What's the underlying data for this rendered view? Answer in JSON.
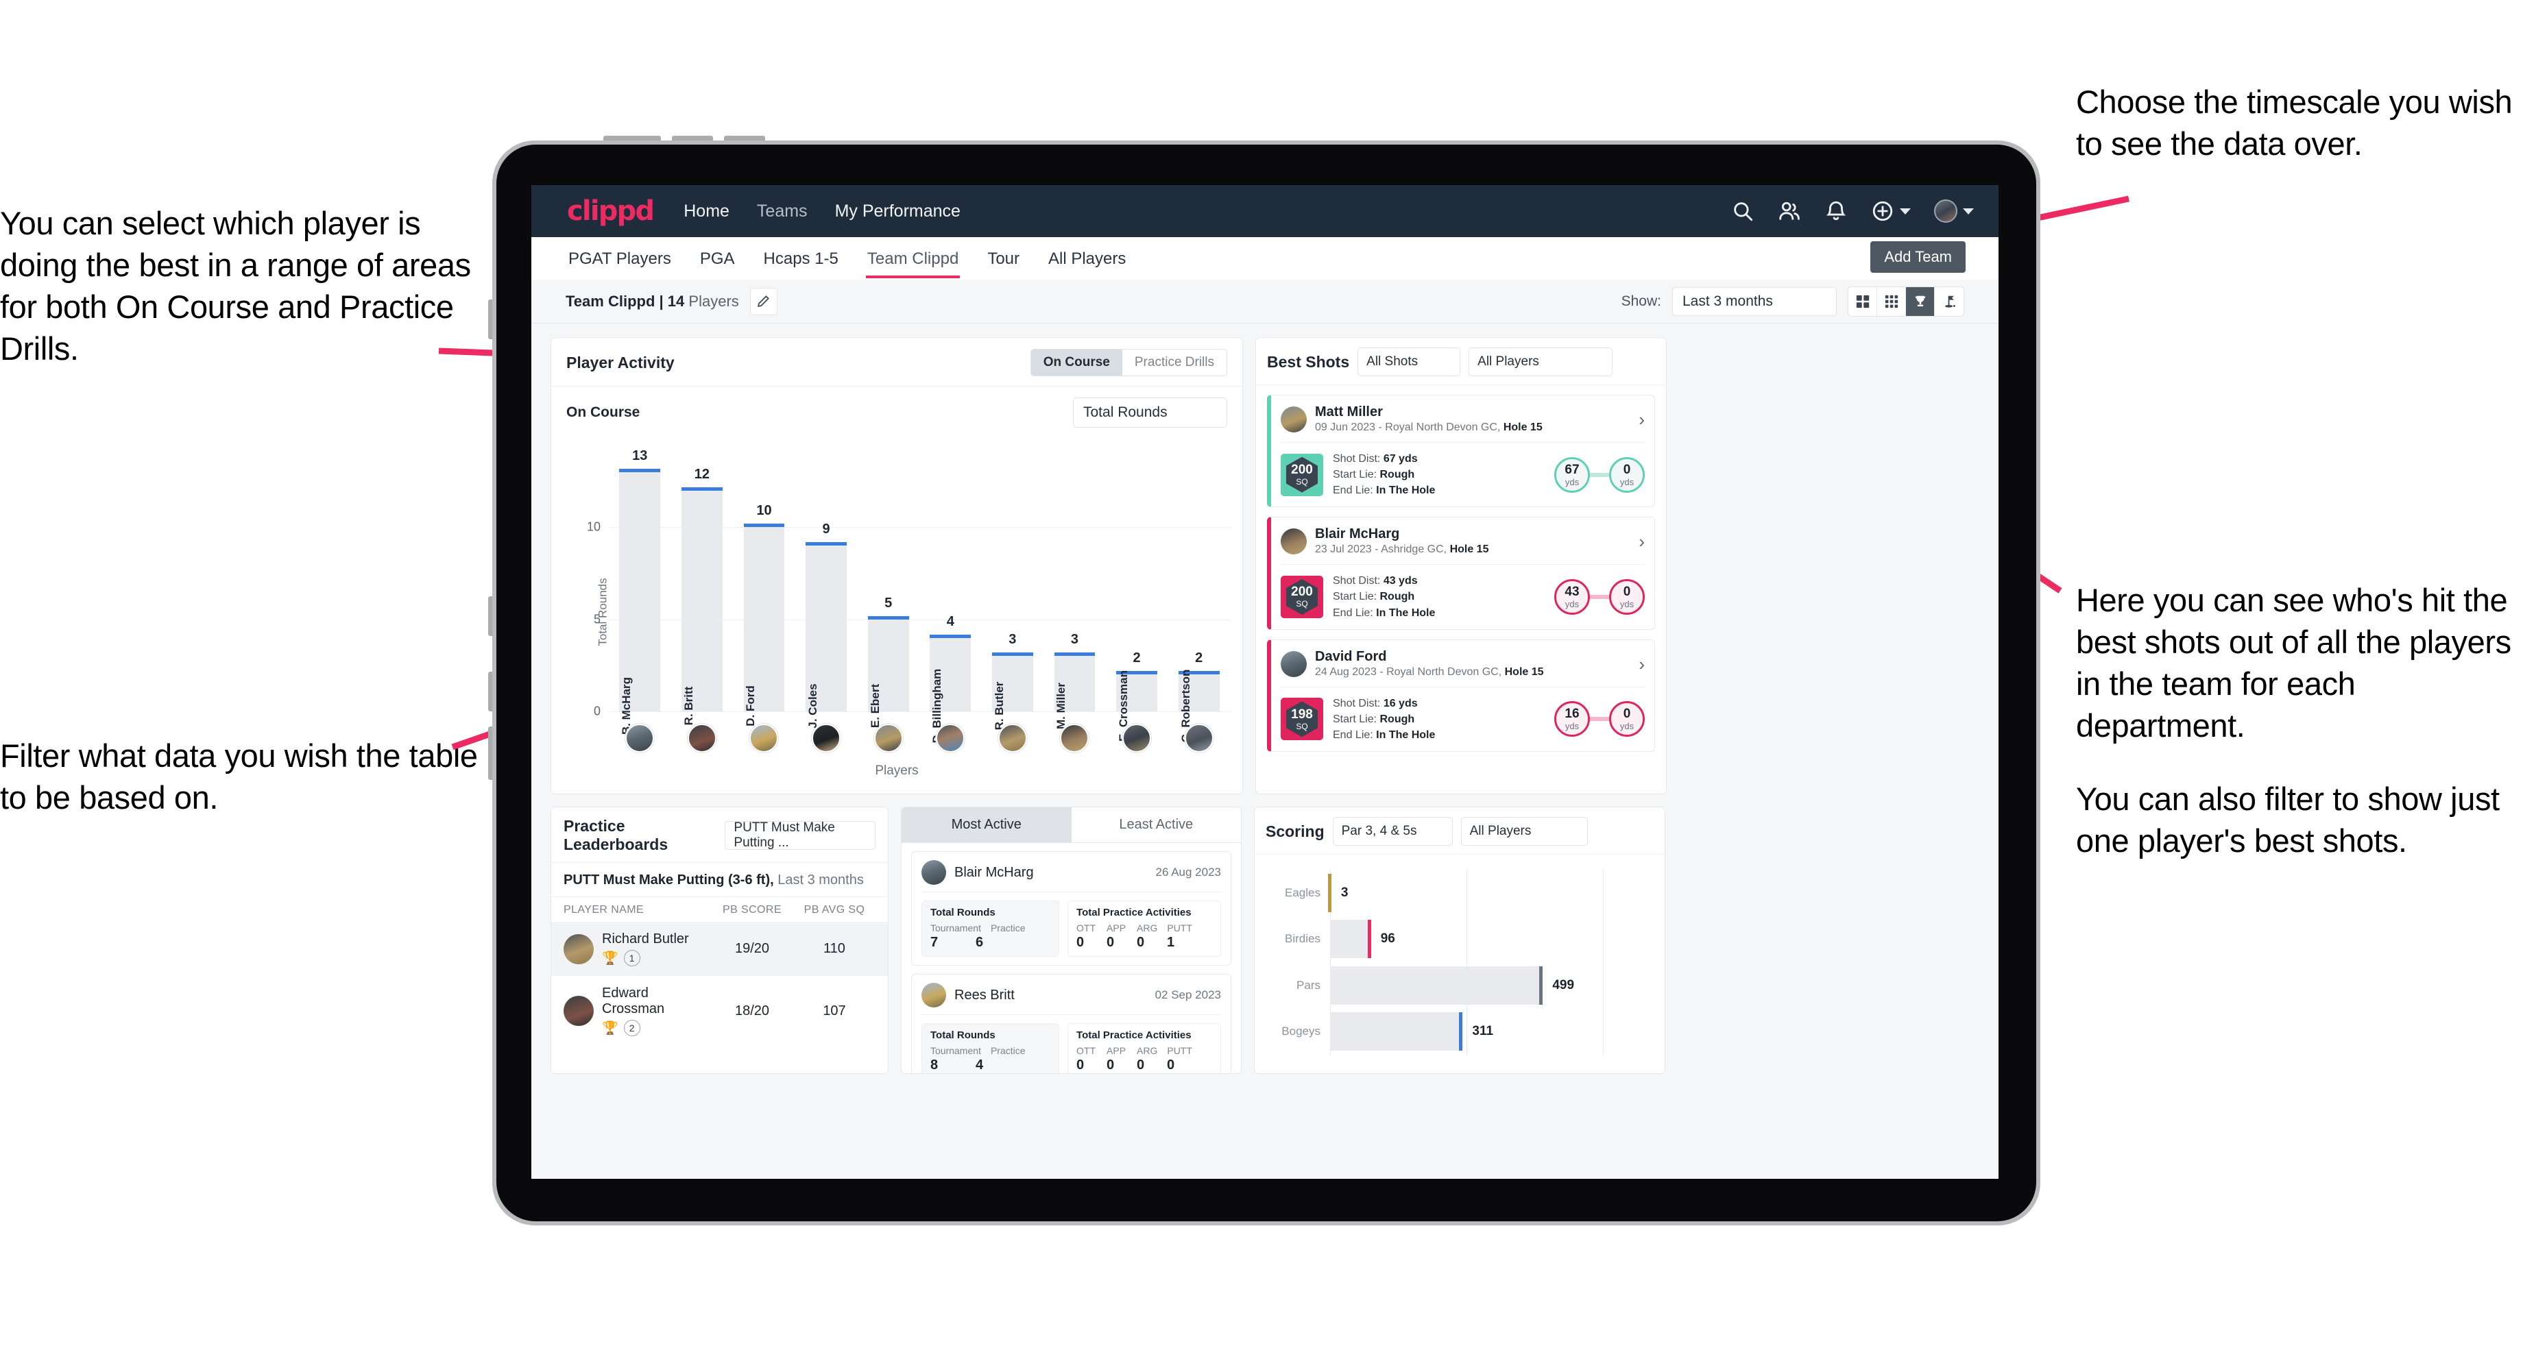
{
  "annotations": {
    "left_top": "You can select which player is doing the best in a range of areas for both On Course and Practice Drills.",
    "left_bottom": "Filter what data you wish the table to be based on.",
    "right_top": "Choose the timescale you wish to see the data over.",
    "right_mid": "Here you can see who's hit the best shots out of all the players in the team for each department.",
    "right_bottom": "You can also filter to show just one player's best shots."
  },
  "navbar": {
    "brand": "clippd",
    "links": [
      {
        "label": "Home"
      },
      {
        "label": "Teams"
      },
      {
        "label": "My Performance"
      }
    ],
    "icons": [
      "search-icon",
      "people-icon",
      "bell-icon",
      "plus-circle-icon",
      "avatar"
    ]
  },
  "subtabs": {
    "items": [
      {
        "label": "PGAT Players",
        "active": false
      },
      {
        "label": "PGA",
        "active": false
      },
      {
        "label": "Hcaps 1-5",
        "active": false
      },
      {
        "label": "Team Clippd",
        "active": true
      },
      {
        "label": "Tour",
        "active": false
      },
      {
        "label": "All Players",
        "active": false
      }
    ],
    "tooltip": "Add Team"
  },
  "toolbar": {
    "team_name": "Team Clippd",
    "team_sep": "|",
    "team_count": "14",
    "team_count_label": "Players",
    "edit_icon": "pencil-icon",
    "show_label": "Show:",
    "timescale_value": "Last 3 months",
    "view_buttons": [
      {
        "icon": "grid-2x2-icon",
        "active": false
      },
      {
        "icon": "grid-3x3-icon",
        "active": false
      },
      {
        "icon": "trophy-icon",
        "active": true
      },
      {
        "icon": "golf-flag-icon",
        "active": false
      }
    ]
  },
  "player_activity": {
    "title": "Player Activity",
    "segments": [
      {
        "label": "On Course",
        "active": true
      },
      {
        "label": "Practice Drills",
        "active": false
      }
    ],
    "sub_label": "On Course",
    "metric_dropdown": "Total Rounds"
  },
  "chart_data": [
    {
      "type": "bar",
      "title": "Player Activity",
      "xlabel": "Players",
      "ylabel": "Total Rounds",
      "ylim": [
        0,
        14
      ],
      "yticks": [
        0,
        5,
        10
      ],
      "grid": true,
      "categories": [
        "B. McHarg",
        "R. Britt",
        "D. Ford",
        "J. Coles",
        "E. Ebert",
        "D. Billingham",
        "R. Butler",
        "M. Miller",
        "E. Crossman",
        "C. Robertson"
      ],
      "values": [
        13,
        12,
        10,
        9,
        5,
        4,
        3,
        3,
        2,
        2
      ]
    },
    {
      "type": "bar",
      "title": "Scoring",
      "orientation": "horizontal",
      "categories": [
        "Eagles",
        "Birdies",
        "Pars",
        "Bogeys"
      ],
      "values": [
        3,
        96,
        499,
        311
      ],
      "xlim": [
        0,
        640
      ],
      "grid": true,
      "colors": [
        "#c0973f",
        "#ec2b62",
        "#6b7481",
        "#3b7ddd"
      ]
    }
  ],
  "best_shots": {
    "title": "Best Shots",
    "shot_filter": "All Shots",
    "player_filter": "All Players",
    "shots": [
      {
        "name": "Matt Miller",
        "meta_date": "09 Jun 2023 - Royal North Devon GC,",
        "meta_hole": "Hole 15",
        "sq_value": "200",
        "sq_unit": "SQ",
        "accent": "teal",
        "shot_dist_label": "Shot Dist:",
        "shot_dist_value": "67 yds",
        "start_lie_label": "Start Lie:",
        "start_lie_value": "Rough",
        "end_lie_label": "End Lie:",
        "end_lie_value": "In The Hole",
        "from_value": "67",
        "from_unit": "yds",
        "to_value": "0",
        "to_unit": "yds"
      },
      {
        "name": "Blair McHarg",
        "meta_date": "23 Jul 2023 - Ashridge GC,",
        "meta_hole": "Hole 15",
        "sq_value": "200",
        "sq_unit": "SQ",
        "accent": "pink",
        "shot_dist_label": "Shot Dist:",
        "shot_dist_value": "43 yds",
        "start_lie_label": "Start Lie:",
        "start_lie_value": "Rough",
        "end_lie_label": "End Lie:",
        "end_lie_value": "In The Hole",
        "from_value": "43",
        "from_unit": "yds",
        "to_value": "0",
        "to_unit": "yds"
      },
      {
        "name": "David Ford",
        "meta_date": "24 Aug 2023 - Royal North Devon GC,",
        "meta_hole": "Hole 15",
        "sq_value": "198",
        "sq_unit": "SQ",
        "accent": "pink",
        "shot_dist_label": "Shot Dist:",
        "shot_dist_value": "16 yds",
        "start_lie_label": "Start Lie:",
        "start_lie_value": "Rough",
        "end_lie_label": "End Lie:",
        "end_lie_value": "In The Hole",
        "from_value": "16",
        "from_unit": "yds",
        "to_value": "0",
        "to_unit": "yds"
      }
    ]
  },
  "practice_leaderboards": {
    "title": "Practice Leaderboards",
    "drill_dropdown": "PUTT Must Make Putting ...",
    "subtitle_bold": "PUTT Must Make Putting (3-6 ft),",
    "subtitle_rest": "Last 3 months",
    "columns": [
      "PLAYER NAME",
      "PB SCORE",
      "PB AVG SQ"
    ],
    "rows": [
      {
        "name": "Richard Butler",
        "rank": "1",
        "trophy": "gold",
        "pb_score": "19/20",
        "pb_avg_sq": "110"
      },
      {
        "name": "Edward Crossman",
        "rank": "2",
        "trophy": "silver",
        "pb_score": "18/20",
        "pb_avg_sq": "107"
      }
    ]
  },
  "activity": {
    "tabs": [
      {
        "label": "Most Active",
        "active": true
      },
      {
        "label": "Least Active",
        "active": false
      }
    ],
    "cards": [
      {
        "name": "Blair McHarg",
        "date": "26 Aug 2023",
        "rounds_title": "Total Rounds",
        "rounds_labels": [
          "Tournament",
          "Practice"
        ],
        "rounds_values": [
          "7",
          "6"
        ],
        "practice_title": "Total Practice Activities",
        "practice_labels": [
          "OTT",
          "APP",
          "ARG",
          "PUTT"
        ],
        "practice_values": [
          "0",
          "0",
          "0",
          "1"
        ]
      },
      {
        "name": "Rees Britt",
        "date": "02 Sep 2023",
        "rounds_title": "Total Rounds",
        "rounds_labels": [
          "Tournament",
          "Practice"
        ],
        "rounds_values": [
          "8",
          "4"
        ],
        "practice_title": "Total Practice Activities",
        "practice_labels": [
          "OTT",
          "APP",
          "ARG",
          "PUTT"
        ],
        "practice_values": [
          "0",
          "0",
          "0",
          "0"
        ]
      }
    ]
  },
  "scoring": {
    "title": "Scoring",
    "par_filter": "Par 3, 4 & 5s",
    "player_filter": "All Players"
  },
  "colors": {
    "brand_pink": "#ec2b62",
    "nav_dark": "#1e2c3c",
    "bar_blue": "#3b7ddd",
    "teal": "#5ed0b4",
    "crimson": "#e0245e",
    "gold": "#c0973f"
  }
}
